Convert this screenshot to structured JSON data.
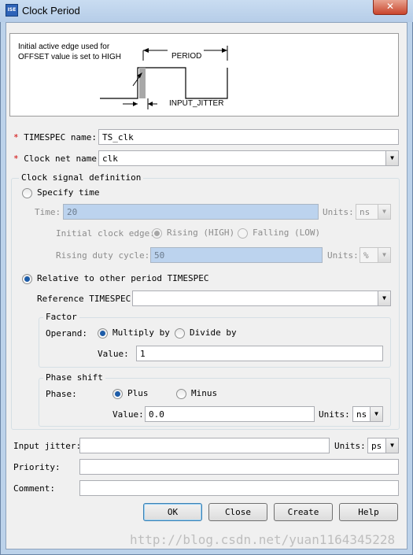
{
  "window": {
    "title": "Clock Period",
    "app_icon_text": "ISE",
    "close_glyph": "✕"
  },
  "diagram": {
    "note_line1": "Initial active edge used for",
    "note_line2": "OFFSET value is set to HIGH",
    "period_label": "PERIOD",
    "jitter_label": "INPUT_JITTER"
  },
  "timespec_name": {
    "required_mark": "*",
    "label": "TIMESPEC name:",
    "value": "TS_clk"
  },
  "clock_net_name": {
    "required_mark": "*",
    "label": "Clock net name:",
    "value": "clk"
  },
  "clock_signal_definition": {
    "title": "Clock signal definition",
    "specify_time": {
      "label": "Specify time",
      "selected": false,
      "time_label": "Time:",
      "time_value": "20",
      "units_label": "Units:",
      "units_value": "ns",
      "edge_label": "Initial clock edge:",
      "rising_label": "Rising (HIGH)",
      "falling_label": "Falling (LOW)",
      "duty_label": "Rising duty cycle:",
      "duty_value": "50",
      "duty_units_label": "Units:",
      "duty_units_value": "%"
    },
    "relative": {
      "label": "Relative to other period TIMESPEC",
      "selected": true,
      "reference_label": "Reference TIMESPEC:",
      "reference_value": "",
      "factor": {
        "title": "Factor",
        "operand_label": "Operand:",
        "multiply_label": "Multiply by",
        "divide_label": "Divide by",
        "value_label": "Value:",
        "value": "1"
      },
      "phase_shift": {
        "title": "Phase shift",
        "phase_label": "Phase:",
        "plus_label": "Plus",
        "minus_label": "Minus",
        "value_label": "Value:",
        "value": "0.0",
        "units_label": "Units:",
        "units_value": "ns"
      }
    }
  },
  "input_jitter": {
    "label": "Input jitter:",
    "value": "",
    "units_label": "Units:",
    "units_value": "ps"
  },
  "priority": {
    "label": "Priority:",
    "value": ""
  },
  "comment": {
    "label": "Comment:",
    "value": ""
  },
  "buttons": {
    "ok": "OK",
    "close": "Close",
    "create": "Create",
    "help": "Help"
  },
  "watermark": "http://blog.csdn.net/yuan1164345228",
  "colors": {
    "disabled_field": "#bcd3ee",
    "required_mark": "#d00000",
    "radio_selected": "#1d5ca8"
  }
}
